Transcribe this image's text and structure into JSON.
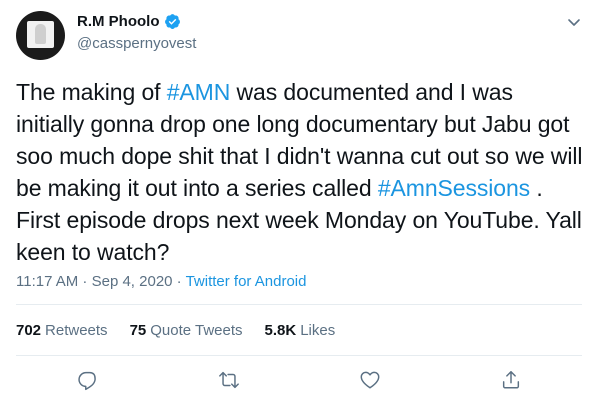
{
  "user": {
    "display_name": "R.M Phoolo",
    "handle": "@casspernyovest",
    "verified": true,
    "avatar_icon": "avatar-image"
  },
  "tweet": {
    "segments": [
      {
        "text": "The making of ",
        "type": "text"
      },
      {
        "text": "#AMN",
        "type": "hashtag"
      },
      {
        "text": " was documented and I was initially gonna drop one long documentary but Jabu got soo much dope shit that I didn't wanna cut out so we will be making it out into a series called ",
        "type": "text"
      },
      {
        "text": "#AmnSessions",
        "type": "hashtag"
      },
      {
        "text": " . First episode drops next week Monday on YouTube. Yall keen to watch?",
        "type": "text"
      }
    ]
  },
  "meta": {
    "time": "11:17 AM",
    "separator": " · ",
    "date": "Sep 4, 2020",
    "source": "Twitter for Android"
  },
  "stats": {
    "retweets_count": "702",
    "retweets_label": "Retweets",
    "quotes_count": "75",
    "quotes_label": "Quote Tweets",
    "likes_count": "5.8K",
    "likes_label": "Likes"
  },
  "colors": {
    "link": "#1b95e0",
    "secondary": "#5b7083",
    "verified": "#1da1f2",
    "text": "#0f1419"
  },
  "actions": {
    "icons": [
      "reply-icon",
      "retweet-icon",
      "like-icon",
      "share-icon"
    ]
  }
}
